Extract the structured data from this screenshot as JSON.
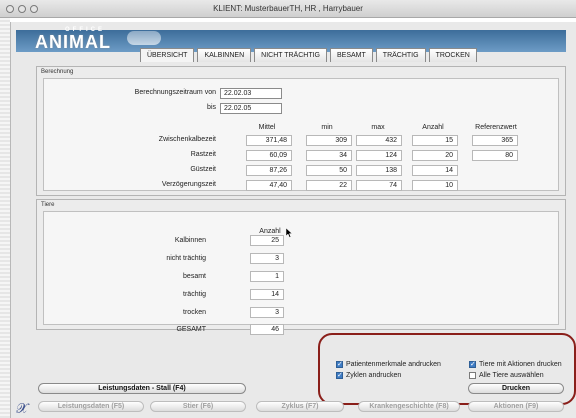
{
  "window": {
    "title": "KLIENT: MusterbauerTH, HR , Harrybauer"
  },
  "logo": {
    "office": "OFFICE",
    "animal": "ANIMAL"
  },
  "tabs": [
    {
      "label": "ÜBERSICHT",
      "active": true
    },
    {
      "label": "KALBINNEN",
      "active": false
    },
    {
      "label": "NICHT TRÄCHTIG",
      "active": false
    },
    {
      "label": "BESAMT",
      "active": false
    },
    {
      "label": "TRÄCHTIG",
      "active": false
    },
    {
      "label": "TROCKEN",
      "active": false
    }
  ],
  "berechnung": {
    "title": "Berechnung",
    "von_label": "Berechnungszeitraum von",
    "von_value": "22.02.03",
    "bis_label": "bis",
    "bis_value": "22.02.05",
    "columns": [
      "Mittel",
      "min",
      "max",
      "Anzahl",
      "Referenzwert"
    ],
    "rows": [
      {
        "label": "Zwischenkalbezeit",
        "values": [
          "371,48",
          "309",
          "432",
          "15",
          "365"
        ]
      },
      {
        "label": "Rastzeit",
        "values": [
          "60,09",
          "34",
          "124",
          "20",
          "80"
        ]
      },
      {
        "label": "Güstzeit",
        "values": [
          "87,26",
          "50",
          "138",
          "14",
          ""
        ]
      },
      {
        "label": "Verzögerungszeit",
        "values": [
          "47,40",
          "22",
          "74",
          "10",
          ""
        ]
      }
    ]
  },
  "tiere": {
    "title": "Tiere",
    "column": "Anzahl",
    "rows": [
      {
        "label": "Kalbinnen",
        "value": "25"
      },
      {
        "label": "nicht trächtig",
        "value": "3"
      },
      {
        "label": "besamt",
        "value": "1"
      },
      {
        "label": "trächtig",
        "value": "14"
      },
      {
        "label": "trocken",
        "value": "3"
      },
      {
        "label": "GESAMT",
        "value": "46"
      }
    ]
  },
  "print_options": {
    "patientenmerkmale": {
      "label": "Patientenmerkmale andrucken",
      "checked": true
    },
    "zyklen": {
      "label": "Zyklen andrucken",
      "checked": true
    },
    "tiere_aktionen": {
      "label": "Tiere mit Aktionen drucken",
      "checked": true
    },
    "alle_tiere": {
      "label": "Alle Tiere auswählen",
      "checked": false
    },
    "drucken_label": "Drucken"
  },
  "bottom_buttons": {
    "leistungsdaten_stall": "Leistungsdaten  - Stall (F4)",
    "leistungsdaten": "Leistungsdaten (F5)",
    "stier": "Stier (F6)",
    "zyklus": "Zyklus (F7)",
    "krankengeschichte": "Krankengeschichte (F8)",
    "aktionen": "Aktionen (F9)"
  },
  "colors": {
    "accent": "#3d6d9a",
    "highlight": "#8a1f1a",
    "checkbox": "#3f7cc4"
  },
  "icons": {
    "app_exit": "x-icon"
  }
}
